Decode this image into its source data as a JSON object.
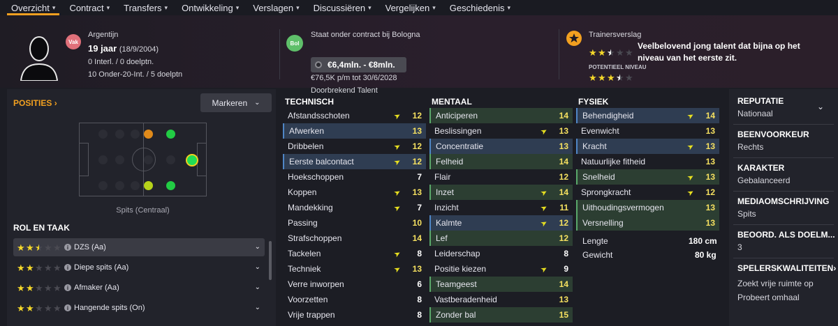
{
  "nav": {
    "tabs": [
      {
        "label": "Overzicht"
      },
      {
        "label": "Contract"
      },
      {
        "label": "Transfers"
      },
      {
        "label": "Ontwikkeling"
      },
      {
        "label": "Verslagen"
      },
      {
        "label": "Discussiëren"
      },
      {
        "label": "Vergelijken"
      },
      {
        "label": "Geschiedenis"
      }
    ]
  },
  "header": {
    "nationality_badge": "Vak",
    "nationality": "Argentijn",
    "age": "19 jaar",
    "birthdate": "(18/9/2004)",
    "intl_caps": "0 Interl. / 0 doelptn.",
    "youth_caps": "10 Onder-20-Int. / 5 doelptn",
    "club_badge": "Bol",
    "contract_status": "Staat onder contract bij Bologna",
    "value_range": "€6,4mln. - €8mln.",
    "wage": "€76,5K p/m tot 30/6/2028",
    "status": "Doorbrekend Talent",
    "coach_report_title": "Trainersverslag",
    "coach_report_text": "Veelbelovend jong talent dat bijna op het niveau van het eerste zit.",
    "potential_label": "POTENTIEEL NIVEAU",
    "current_stars": 2.5,
    "potential_stars": 3.5
  },
  "positions": {
    "title": "POSITIES",
    "mark_button": "Markeren",
    "position_label": "Spits (Centraal)"
  },
  "roles": {
    "title": "ROL EN TAAK",
    "items": [
      {
        "label": "DZS (Aa)",
        "stars": 2.5
      },
      {
        "label": "Diepe spits (Aa)",
        "stars": 2
      },
      {
        "label": "Afmaker (Aa)",
        "stars": 2
      },
      {
        "label": "Hangende spits (On)",
        "stars": 2
      }
    ]
  },
  "technical": {
    "title": "TECHNISCH",
    "rows": [
      {
        "name": "Afstandsschoten",
        "value": "12",
        "arrow": true,
        "hl": "none"
      },
      {
        "name": "Afwerken",
        "value": "13",
        "arrow": false,
        "hl": "blue"
      },
      {
        "name": "Dribbelen",
        "value": "12",
        "arrow": true,
        "hl": "none"
      },
      {
        "name": "Eerste balcontact",
        "value": "12",
        "arrow": true,
        "hl": "blue"
      },
      {
        "name": "Hoekschoppen",
        "value": "7",
        "arrow": false,
        "hl": "none"
      },
      {
        "name": "Koppen",
        "value": "13",
        "arrow": true,
        "hl": "none"
      },
      {
        "name": "Mandekking",
        "value": "7",
        "arrow": true,
        "hl": "none"
      },
      {
        "name": "Passing",
        "value": "10",
        "arrow": false,
        "hl": "none"
      },
      {
        "name": "Strafschoppen",
        "value": "14",
        "arrow": false,
        "hl": "none"
      },
      {
        "name": "Tackelen",
        "value": "8",
        "arrow": true,
        "hl": "none"
      },
      {
        "name": "Techniek",
        "value": "13",
        "arrow": true,
        "hl": "none"
      },
      {
        "name": "Verre inworpen",
        "value": "6",
        "arrow": false,
        "hl": "none"
      },
      {
        "name": "Voorzetten",
        "value": "8",
        "arrow": false,
        "hl": "none"
      },
      {
        "name": "Vrije trappen",
        "value": "8",
        "arrow": false,
        "hl": "none"
      }
    ]
  },
  "mental": {
    "title": "MENTAAL",
    "rows": [
      {
        "name": "Anticiperen",
        "value": "14",
        "arrow": false,
        "hl": "green"
      },
      {
        "name": "Beslissingen",
        "value": "13",
        "arrow": true,
        "hl": "none"
      },
      {
        "name": "Concentratie",
        "value": "13",
        "arrow": false,
        "hl": "blue"
      },
      {
        "name": "Felheid",
        "value": "14",
        "arrow": false,
        "hl": "green"
      },
      {
        "name": "Flair",
        "value": "12",
        "arrow": false,
        "hl": "none"
      },
      {
        "name": "Inzet",
        "value": "14",
        "arrow": true,
        "hl": "green"
      },
      {
        "name": "Inzicht",
        "value": "11",
        "arrow": true,
        "hl": "none"
      },
      {
        "name": "Kalmte",
        "value": "12",
        "arrow": true,
        "hl": "blue"
      },
      {
        "name": "Lef",
        "value": "12",
        "arrow": false,
        "hl": "green"
      },
      {
        "name": "Leiderschap",
        "value": "8",
        "arrow": false,
        "hl": "none"
      },
      {
        "name": "Positie kiezen",
        "value": "9",
        "arrow": true,
        "hl": "none"
      },
      {
        "name": "Teamgeest",
        "value": "14",
        "arrow": false,
        "hl": "green"
      },
      {
        "name": "Vastberadenheid",
        "value": "13",
        "arrow": false,
        "hl": "none"
      },
      {
        "name": "Zonder bal",
        "value": "15",
        "arrow": false,
        "hl": "green"
      }
    ]
  },
  "physical": {
    "title": "FYSIEK",
    "rows": [
      {
        "name": "Behendigheid",
        "value": "14",
        "arrow": true,
        "hl": "blue"
      },
      {
        "name": "Evenwicht",
        "value": "13",
        "arrow": false,
        "hl": "none"
      },
      {
        "name": "Kracht",
        "value": "13",
        "arrow": true,
        "hl": "blue"
      },
      {
        "name": "Natuurlijke fitheid",
        "value": "13",
        "arrow": false,
        "hl": "none"
      },
      {
        "name": "Snelheid",
        "value": "13",
        "arrow": true,
        "hl": "green"
      },
      {
        "name": "Sprongkracht",
        "value": "12",
        "arrow": true,
        "hl": "none"
      },
      {
        "name": "Uithoudingsvermogen",
        "value": "13",
        "arrow": false,
        "hl": "green"
      },
      {
        "name": "Versnelling",
        "value": "13",
        "arrow": false,
        "hl": "green"
      }
    ],
    "height_label": "Lengte",
    "height": "180 cm",
    "weight_label": "Gewicht",
    "weight": "80 kg"
  },
  "info": {
    "reputation_title": "REPUTATIE",
    "reputation": "Nationaal",
    "foot_title": "BEENVOORKEUR",
    "foot": "Rechts",
    "character_title": "KARAKTER",
    "character": "Gebalanceerd",
    "media_title": "MEDIAOMSCHRIJVING",
    "media": "Spits",
    "gk_title": "BEOORD. ALS DOELM...",
    "gk": "3",
    "traits_title": "SPELERSKWALITEITEN",
    "traits": [
      "Zoekt vrije ruimte op",
      "Probeert omhaal"
    ]
  },
  "colors": {
    "accent": "#f2a020",
    "star": "#f5d82a",
    "highlight_blue": "#2f3d52",
    "highlight_green": "#2c3e32"
  }
}
